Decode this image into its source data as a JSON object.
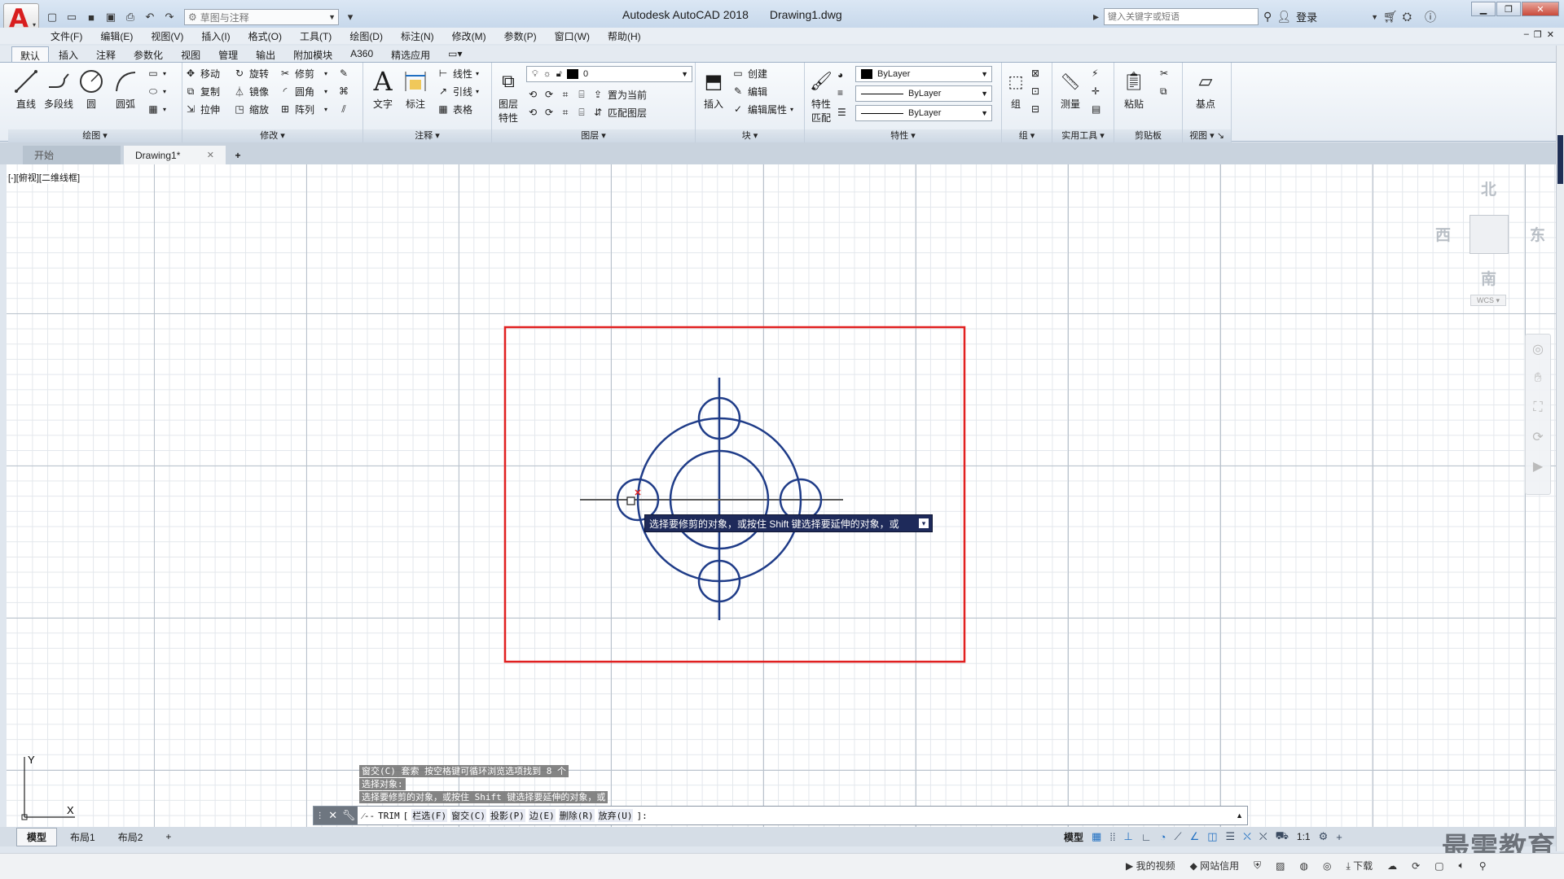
{
  "title_bar": {
    "app_letter": "A",
    "app_name": "Autodesk AutoCAD 2018",
    "document": "Drawing1.dwg",
    "workspace": "草图与注释",
    "search_placeholder": "键入关键字或短语",
    "login": "登录"
  },
  "menu": [
    "文件(F)",
    "编辑(E)",
    "视图(V)",
    "插入(I)",
    "格式(O)",
    "工具(T)",
    "绘图(D)",
    "标注(N)",
    "修改(M)",
    "参数(P)",
    "窗口(W)",
    "帮助(H)"
  ],
  "ribbon_tabs": [
    "默认",
    "插入",
    "注释",
    "参数化",
    "视图",
    "管理",
    "输出",
    "附加模块",
    "A360",
    "精选应用"
  ],
  "ribbon": {
    "draw": {
      "title": "绘图",
      "line": "直线",
      "polyline": "多段线",
      "circle": "圆",
      "arc": "圆弧"
    },
    "modify": {
      "title": "修改",
      "move": "移动",
      "rotate": "旋转",
      "trim": "修剪",
      "copy": "复制",
      "mirror": "镜像",
      "fillet": "圆角",
      "stretch": "拉伸",
      "scale": "缩放",
      "array": "阵列"
    },
    "annotation": {
      "title": "注释",
      "text": "文字",
      "dimension": "标注",
      "linear": "线性",
      "leader": "引线",
      "table": "表格"
    },
    "layers": {
      "title": "图层",
      "layer_props_1": "图层",
      "layer_props_2": "特性",
      "current_layer": "0",
      "set_current": "置为当前",
      "match_layer": "匹配图层"
    },
    "block": {
      "title": "块",
      "insert": "插入",
      "create": "创建",
      "edit": "编辑",
      "edit_attr": "编辑属性"
    },
    "properties": {
      "title": "特性",
      "match_1": "特性",
      "match_2": "匹配",
      "color": "ByLayer",
      "linetype": "ByLayer",
      "lineweight": "ByLayer"
    },
    "groups": {
      "title": "组",
      "group": "组"
    },
    "utilities": {
      "title": "实用工具",
      "measure": "测量"
    },
    "clipboard": {
      "title": "剪贴板",
      "paste": "粘贴"
    },
    "view": {
      "title": "视图",
      "base": "基点"
    }
  },
  "file_tabs": {
    "start": "开始",
    "doc": "Drawing1*"
  },
  "viewport_label": "[-][俯视][二维线框]",
  "viewcube": {
    "north": "北",
    "south": "南",
    "east": "东",
    "west": "西",
    "wcs": "WCS"
  },
  "ucs": {
    "x": "X",
    "y": "Y"
  },
  "tooltip": "选择要修剪的对象，或按住 Shift 键选择要延伸的对象，或",
  "command_history": [
    "窗交(C) 套索  按空格键可循环浏览选项找到 8 个",
    "选择对象:",
    "选择要修剪的对象，或按住 Shift 键选择要延伸的对象，或"
  ],
  "command_line": {
    "command": "TRIM",
    "options": [
      "栏选(F)",
      "窗交(C)",
      "投影(P)",
      "边(E)",
      "删除(R)",
      "放弃(U)"
    ],
    "suffix": "]:"
  },
  "layout_tabs": [
    "模型",
    "布局1",
    "布局2"
  ],
  "status": {
    "model": "模型",
    "scale": "1:1"
  },
  "bottom_bar": {
    "my_video": "我的视频",
    "net_credit": "网站信用",
    "download": "下载"
  },
  "watermark": "最需教育",
  "colors": {
    "accent_blue": "#1f3c88",
    "selection_red": "#e12020",
    "title_gradient": "#c4d6ea",
    "tooltip_bg": "#1e2a5a"
  }
}
